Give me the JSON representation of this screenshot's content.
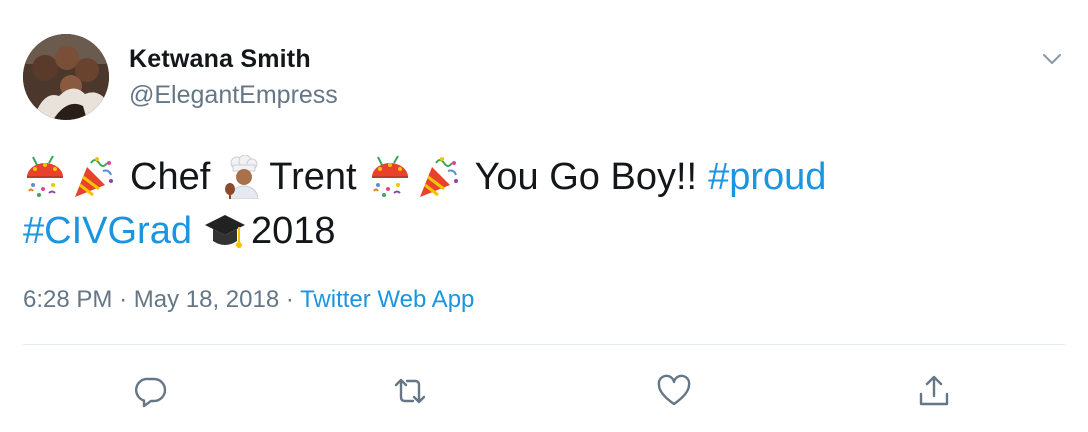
{
  "user": {
    "name": "Ketwana Smith",
    "handle": "@ElegantEmpress"
  },
  "tweet": {
    "line1": {
      "word_chef": "Chef",
      "word_trent": "Trent",
      "phrase": "You Go Boy!!",
      "hashtag_proud": "#proud"
    },
    "line2": {
      "hashtag_civgrad": "#CIVGrad",
      "year": "2018"
    },
    "emojis": [
      "confetti-ball",
      "party-popper",
      "chef",
      "graduation-cap"
    ]
  },
  "meta": {
    "time": "6:28 PM",
    "separator": "·",
    "date": "May 18, 2018",
    "source": "Twitter Web App"
  },
  "colors": {
    "link": "#1b95e0",
    "secondary_text": "#657786",
    "primary_text": "#14171a",
    "divider": "#e6ecf0"
  },
  "actions": [
    "reply-icon",
    "retweet-icon",
    "like-icon",
    "share-icon"
  ]
}
